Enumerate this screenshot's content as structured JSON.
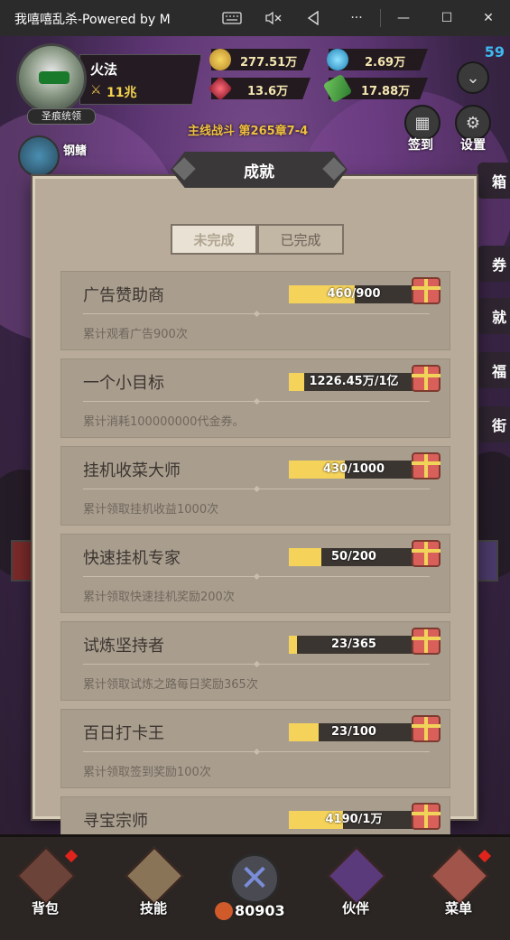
{
  "window": {
    "title": "我嘻嘻乱杀-Powered by M",
    "keyboard_icon": "keyboard-icon",
    "mute_icon": "speaker-mute-icon",
    "back_icon": "back-triangle-icon",
    "more_label": "···",
    "minimize_label": "—",
    "maximize_label": "☐",
    "close_label": "✕"
  },
  "hud": {
    "player_name": "火法",
    "power": "11兆",
    "title_badge": "圣痕统领",
    "level": "59",
    "resources": {
      "gold": "277.51万",
      "diamond": "2.69万",
      "ruby": "13.6万",
      "coupon": "17.88万"
    },
    "chapter": "主线战斗 第265章7-4",
    "enemy_name": "钢鳍",
    "sign_in_label": "签到",
    "settings_label": "设置"
  },
  "dialog": {
    "title": "成就",
    "tabs": [
      "未完成",
      "已完成"
    ],
    "achievements": [
      {
        "title": "广告赞助商",
        "desc": "累计观看广告900次",
        "progress_text": "460/900",
        "progress": 0.511
      },
      {
        "title": "一个小目标",
        "desc": "累计消耗100000000代金券。",
        "progress_text": "1226.45万/1亿",
        "progress": 0.123
      },
      {
        "title": "挂机收菜大师",
        "desc": "累计领取挂机收益1000次",
        "progress_text": "430/1000",
        "progress": 0.43
      },
      {
        "title": "快速挂机专家",
        "desc": "累计领取快速挂机奖励200次",
        "progress_text": "50/200",
        "progress": 0.25
      },
      {
        "title": "试炼坚持者",
        "desc": "累计领取试炼之路每日奖励365次",
        "progress_text": "23/365",
        "progress": 0.063
      },
      {
        "title": "百日打卡王",
        "desc": "累计领取签到奖励100次",
        "progress_text": "23/100",
        "progress": 0.23
      },
      {
        "title": "寻宝宗师",
        "desc": "",
        "progress_text": "4190/1万",
        "progress": 0.419
      }
    ]
  },
  "bottom_nav": {
    "items": [
      "背包",
      "技能",
      "伙伴",
      "菜单"
    ],
    "center_value": "80903",
    "footer_id": "ID: r e0739f5163f1445c92e0f458a75866bc"
  },
  "colors": {
    "accent_yellow": "#f5d35a",
    "dialog_bg": "#b8ab99",
    "level_blue": "#3db9f0"
  }
}
